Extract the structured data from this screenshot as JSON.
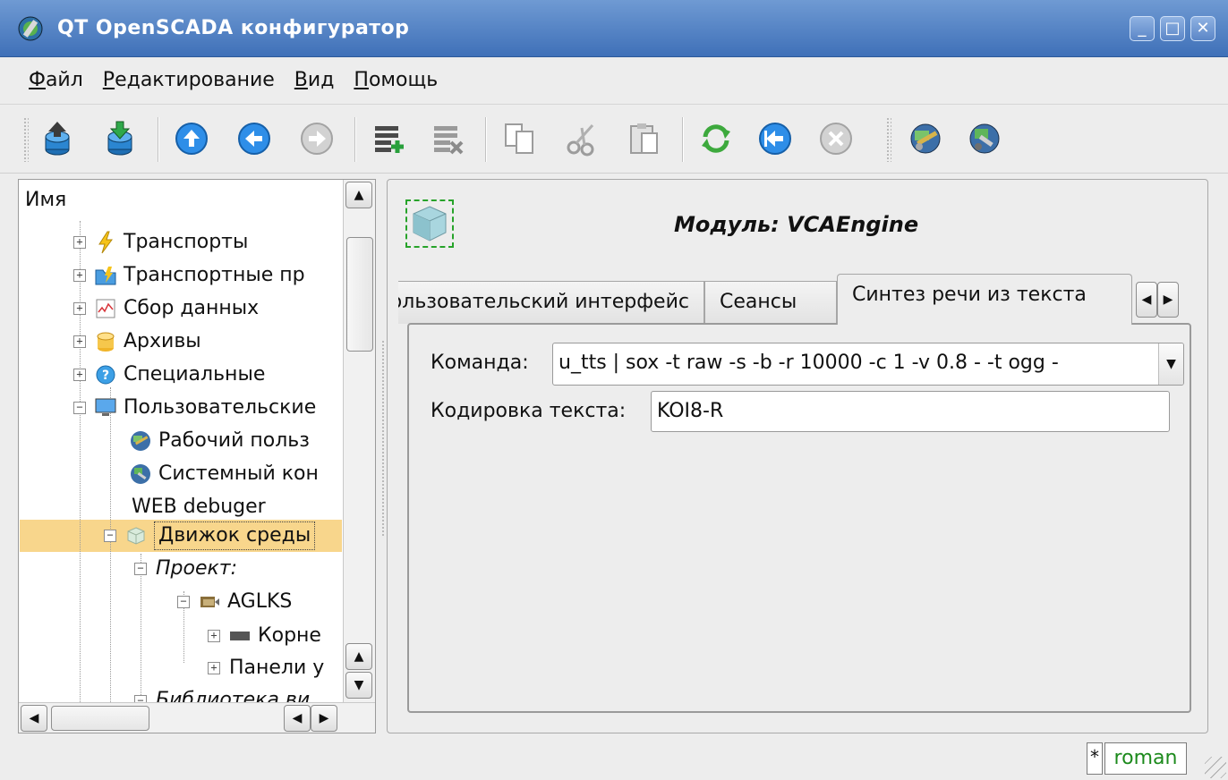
{
  "window": {
    "title": "QT OpenSCADA конфигуратор",
    "minimize": "_",
    "maximize": "□",
    "close": "✕"
  },
  "menu": {
    "file": "Файл",
    "file_accel": "Ф",
    "file_rest": "айл",
    "edit": "Редактирование",
    "edit_accel": "Р",
    "edit_rest": "едактирование",
    "view": "Вид",
    "view_accel": "В",
    "view_rest": "ид",
    "help": "Помощь",
    "help_accel": "П",
    "help_rest": "омощь"
  },
  "toolbar": {
    "icons": [
      "db-load-icon",
      "db-save-icon",
      "up-icon",
      "back-icon",
      "forward-icon",
      "add-item-icon",
      "delete-item-icon",
      "copy-icon",
      "cut-icon",
      "paste-icon",
      "refresh-icon",
      "start-icon",
      "stop-icon",
      "vision-icon",
      "system-icon"
    ]
  },
  "tree": {
    "header": "Имя",
    "items": [
      {
        "label": "Транспорты",
        "icon": "lightning-icon"
      },
      {
        "label": "Транспортные пр",
        "icon": "folder-icon"
      },
      {
        "label": "Сбор данных",
        "icon": "chart-icon"
      },
      {
        "label": "Архивы",
        "icon": "archive-icon"
      },
      {
        "label": "Специальные",
        "icon": "question-icon"
      },
      {
        "label": "Пользовательские",
        "icon": "monitor-icon"
      },
      {
        "label": "Рабочий польз",
        "icon": "vision-icon"
      },
      {
        "label": "Системный кон",
        "icon": "system-icon"
      },
      {
        "label": "WEB debuger",
        "icon": ""
      },
      {
        "label": "Движок среды",
        "icon": "cube-icon"
      },
      {
        "label": "Проект:",
        "icon": ""
      },
      {
        "label": "AGLKS",
        "icon": "project-icon"
      },
      {
        "label": "Корне",
        "icon": "page-icon"
      },
      {
        "label": "Панели у",
        "icon": ""
      },
      {
        "label": "Библиотека ви",
        "icon": ""
      }
    ]
  },
  "module": {
    "title": "Модуль: VCAEngine",
    "icon": "cube-icon"
  },
  "tabs": [
    {
      "label": "Пользовательский интерфейс",
      "visible": "ователький интерфейс"
    },
    {
      "label": "Сеансы"
    },
    {
      "label": "Синтез речи из текста"
    }
  ],
  "form": {
    "command_label": "Команда:",
    "command_value": "u_tts | sox -t raw -s -b -r 10000 -c 1 -v 0.8 - -t ogg -",
    "encoding_label": "Кодировка текста:",
    "encoding_value": "KOI8-R"
  },
  "status": {
    "modified": "*",
    "user": "roman"
  }
}
